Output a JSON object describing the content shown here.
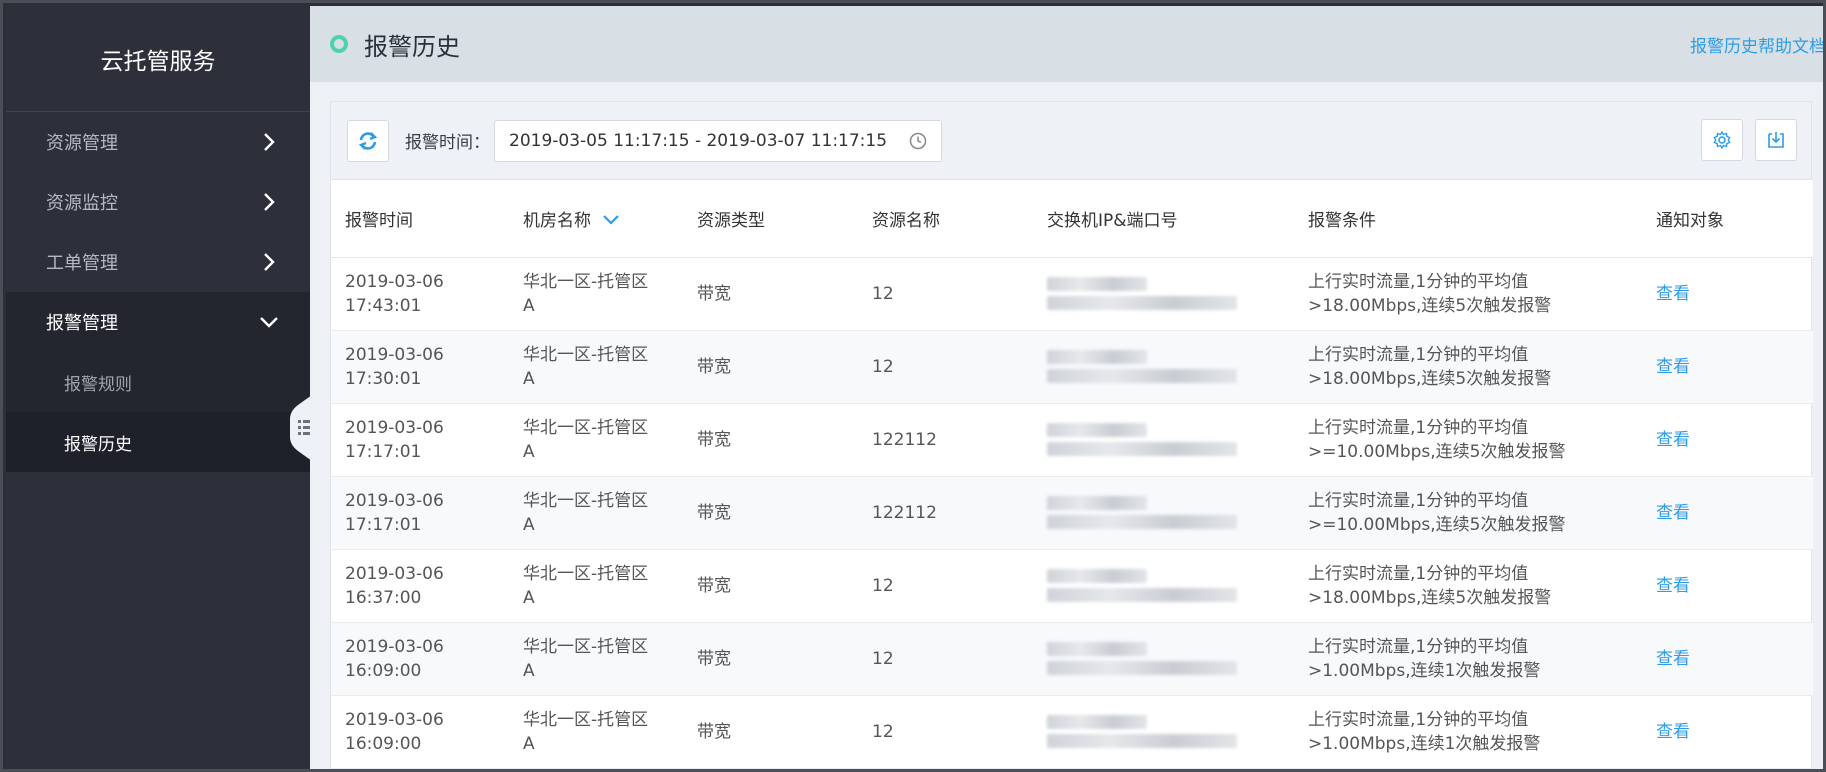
{
  "sidebar": {
    "brand": "云托管服务",
    "items": [
      {
        "label": "资源管理"
      },
      {
        "label": "资源监控"
      },
      {
        "label": "工单管理"
      },
      {
        "label": "报警管理"
      }
    ],
    "sub_items": [
      {
        "label": "报警规则"
      },
      {
        "label": "报警历史"
      }
    ]
  },
  "header": {
    "title": "报警历史",
    "help_link": "报警历史帮助文档"
  },
  "toolbar": {
    "date_label": "报警时间：",
    "date_range": "2019-03-05 11:17:15 - 2019-03-07 11:17:15"
  },
  "table": {
    "columns": [
      "报警时间",
      "机房名称",
      "资源类型",
      "资源名称",
      "交换机IP&端口号",
      "报警条件",
      "通知对象"
    ],
    "rows": [
      {
        "date": "2019-03-06",
        "time": "17:43:01",
        "room1": "华北一区-托管区",
        "room2": "A",
        "type": "带宽",
        "name": "12",
        "cond1": "上行实时流量,1分钟的平均值",
        "cond2": ">18.00Mbps,连续5次触发报警",
        "action": "查看"
      },
      {
        "date": "2019-03-06",
        "time": "17:30:01",
        "room1": "华北一区-托管区",
        "room2": "A",
        "type": "带宽",
        "name": "12",
        "cond1": "上行实时流量,1分钟的平均值",
        "cond2": ">18.00Mbps,连续5次触发报警",
        "action": "查看"
      },
      {
        "date": "2019-03-06",
        "time": "17:17:01",
        "room1": "华北一区-托管区",
        "room2": "A",
        "type": "带宽",
        "name": "122112",
        "cond1": "上行实时流量,1分钟的平均值",
        "cond2": ">=10.00Mbps,连续5次触发报警",
        "action": "查看"
      },
      {
        "date": "2019-03-06",
        "time": "17:17:01",
        "room1": "华北一区-托管区",
        "room2": "A",
        "type": "带宽",
        "name": "122112",
        "cond1": "上行实时流量,1分钟的平均值",
        "cond2": ">=10.00Mbps,连续5次触发报警",
        "action": "查看"
      },
      {
        "date": "2019-03-06",
        "time": "16:37:00",
        "room1": "华北一区-托管区",
        "room2": "A",
        "type": "带宽",
        "name": "12",
        "cond1": "上行实时流量,1分钟的平均值",
        "cond2": ">18.00Mbps,连续5次触发报警",
        "action": "查看"
      },
      {
        "date": "2019-03-06",
        "time": "16:09:00",
        "room1": "华北一区-托管区",
        "room2": "A",
        "type": "带宽",
        "name": "12",
        "cond1": "上行实时流量,1分钟的平均值",
        "cond2": ">1.00Mbps,连续1次触发报警",
        "action": "查看"
      },
      {
        "date": "2019-03-06",
        "time": "16:09:00",
        "room1": "华北一区-托管区",
        "room2": "A",
        "type": "带宽",
        "name": "12",
        "cond1": "上行实时流量,1分钟的平均值",
        "cond2": ">1.00Mbps,连续1次触发报警",
        "action": "查看"
      }
    ]
  },
  "colors": {
    "accent": "#2e9de6",
    "status_dot": "#4fd1b0",
    "sidebar_bg": "#2d303b"
  }
}
